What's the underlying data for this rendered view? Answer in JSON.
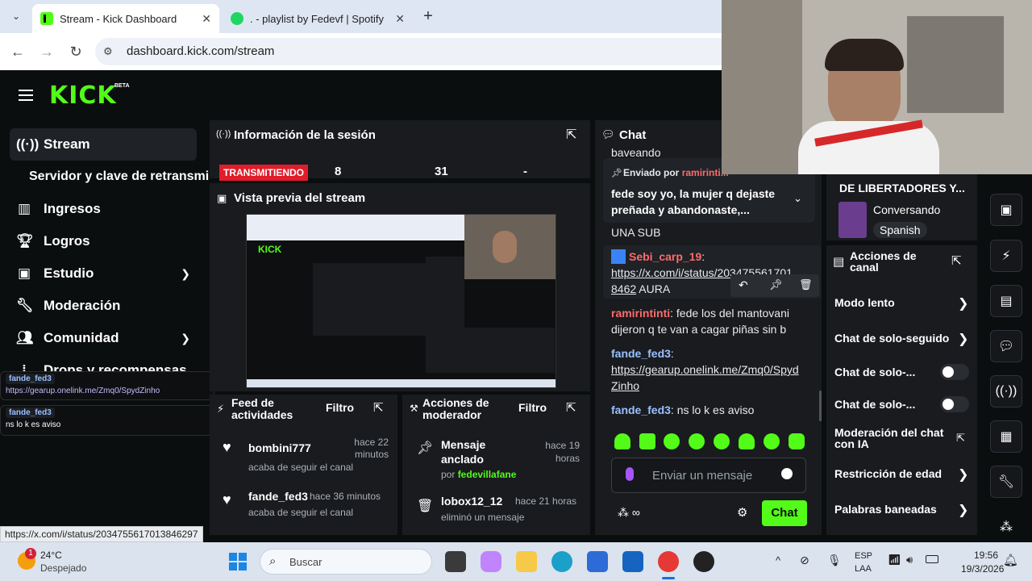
{
  "browser": {
    "tabs": [
      {
        "title": "Stream - Kick Dashboard",
        "active": true
      },
      {
        "title": ". - playlist by Fedevf | Spotify",
        "active": false
      }
    ],
    "url": "dashboard.kick.com/stream"
  },
  "app": {
    "logo": "KICK",
    "logo_badge": "BETA",
    "sidebar": [
      {
        "label": "Stream",
        "icon": "broadcast-icon",
        "active": true
      },
      {
        "label": "Servidor y clave de retransmisión",
        "icon": "",
        "sub": true
      },
      {
        "label": "Ingresos",
        "icon": "bar-chart-icon"
      },
      {
        "label": "Logros",
        "icon": "trophy-icon"
      },
      {
        "label": "Estudio",
        "icon": "studio-icon",
        "chevron": true
      },
      {
        "label": "Moderación",
        "icon": "wrench-icon"
      },
      {
        "label": "Comunidad",
        "icon": "community-icon",
        "chevron": true
      },
      {
        "label": "Drops y recompensas",
        "icon": "drops-icon"
      }
    ],
    "session": {
      "title": "Información de la sesión",
      "status": "TRANSMITIENDO",
      "stats": [
        "8",
        "31",
        "-"
      ]
    },
    "preview": {
      "title": "Vista previa del stream"
    },
    "activity": {
      "title": "Feed de actividades",
      "filter": "Filtro",
      "items": [
        {
          "user": "bombini777",
          "time": "hace 22 minutos",
          "desc": "acaba de seguir el canal"
        },
        {
          "user": "fande_fed3",
          "time": "hace 36 minutos",
          "desc": "acaba de seguir el canal"
        }
      ]
    },
    "mod_actions": {
      "title": "Acciones de moderador",
      "filter": "Filtro",
      "items": [
        {
          "title": "Mensaje anclado",
          "time": "hace 19 horas",
          "by_prefix": "por ",
          "by": "fedevillafane"
        },
        {
          "title": "lobox12_12",
          "time": "hace 21 horas",
          "desc": "eliminó un mensaje"
        }
      ]
    },
    "chat": {
      "title": "Chat",
      "top_partial": "baveando",
      "pinned_by_prefix": "Enviado por ",
      "pinned_by": "ramirinti...",
      "pinned_text": "fede soy yo, la mujer q dejaste preñada y abandonaste,...",
      "messages": [
        {
          "text": "UNA SUB"
        },
        {
          "user": "Sebi_carp_19",
          "sep": ":",
          "link": "https://x.com/i/status/2034755617013846297",
          "link_display_1": "https://x.com/i/status/203475561701",
          "link_display_2": "8462",
          "after": " AURA"
        },
        {
          "user": "ramirintinti",
          "text": ": fede los del mantovani dijeron q te van a cagar piñas sin b"
        },
        {
          "user": "fande_fed3",
          "sep": ":",
          "link_1": "https://gearup.onelink.me/Zmq0/Spyd",
          "link_2": "Zinho"
        },
        {
          "user": "fande_fed3",
          "text": ": ns lo k es aviso"
        }
      ],
      "input_placeholder": "Enviar un mensaje",
      "send_label": "Chat"
    },
    "stream_info": {
      "title_partial": "DE LIBERTADORES Y...",
      "category": "Conversando",
      "language": "Spanish"
    },
    "channel_actions": {
      "title": "Acciones de canal",
      "items": [
        {
          "label": "Modo lento",
          "type": "arrow"
        },
        {
          "label": "Chat de solo-seguido",
          "type": "arrow"
        },
        {
          "label": "Chat de solo-...",
          "type": "toggle"
        },
        {
          "label": "Chat de solo-...",
          "type": "toggle"
        },
        {
          "label": "Moderación del chat con IA",
          "type": "external"
        },
        {
          "label": "Restricción de edad",
          "type": "arrow"
        },
        {
          "label": "Palabras baneadas",
          "type": "arrow"
        }
      ]
    },
    "overlay_chat": [
      {
        "user": "fande_fed3",
        "text": "https://gearup.onelink.me/Zmq0/SpydZinho"
      },
      {
        "user": "fande_fed3",
        "text": "ns lo k es aviso"
      }
    ],
    "status_url": "https://x.com/i/status/2034755617013846297"
  },
  "taskbar": {
    "weather_temp": "24°C",
    "weather_desc": "Despejado",
    "weather_badge": "1",
    "search_placeholder": "Buscar",
    "lang_1": "ESP",
    "lang_2": "LAA",
    "time": "19:56",
    "date": "19/3/2026"
  },
  "colors": {
    "accent": "#53fc18",
    "live_badge": "#e11d2a",
    "panel": "#191b1f",
    "background": "#0b0e0f"
  }
}
